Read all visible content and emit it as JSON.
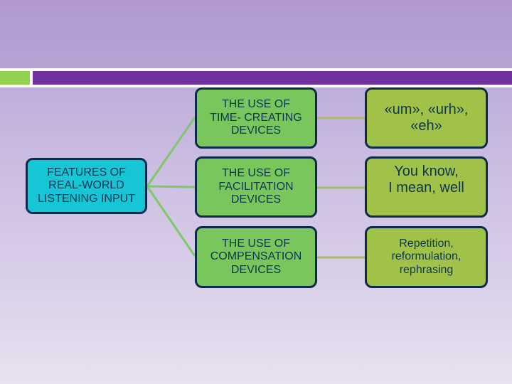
{
  "slide": {
    "accent_colors": {
      "header_band": "#7030a0",
      "header_tab": "#92d050",
      "root_fill": "#16c6d6",
      "middle_fill": "#79c75c",
      "right_fill": "#a1c249",
      "connector_left": "#7dc86a",
      "connector_right": "#a7ba6a",
      "border": "#0e2a4a"
    }
  },
  "diagram": {
    "root": {
      "label": "FEATURES OF\nREAL-WORLD\nLISTENING INPUT"
    },
    "branches": [
      {
        "label": "THE USE OF\nTIME- CREATING\nDEVICES",
        "example": "«um», «urh»,\n«eh»"
      },
      {
        "label": "THE USE OF\nFACILITATION\nDEVICES",
        "example": "You know,\nI mean,   well"
      },
      {
        "label": "THE USE OF\nCOMPENSATION\nDEVICES",
        "example": "Repetition,\nreformulation,\nrephrasing"
      }
    ]
  }
}
